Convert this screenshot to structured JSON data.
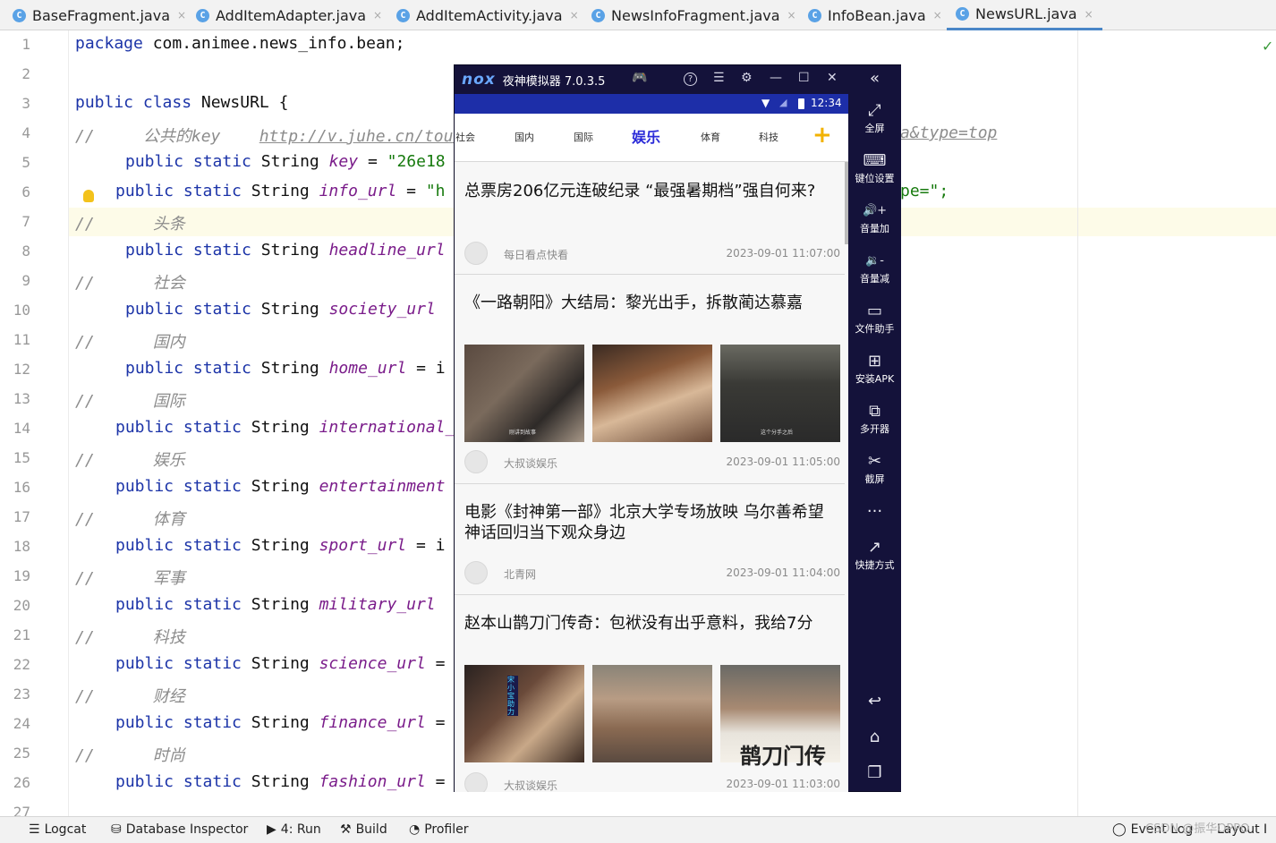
{
  "tabs": [
    {
      "label": "BaseFragment.java",
      "active": false
    },
    {
      "label": "AddItemAdapter.java",
      "active": false
    },
    {
      "label": "AddItemActivity.java",
      "active": false
    },
    {
      "label": "NewsInfoFragment.java",
      "active": false
    },
    {
      "label": "InfoBean.java",
      "active": false
    },
    {
      "label": "NewsURL.java",
      "active": true
    }
  ],
  "tab_icon": "C",
  "tab_close": "×",
  "line_numbers": [
    "1",
    "2",
    "3",
    "4",
    "5",
    "6",
    "7",
    "8",
    "9",
    "10",
    "11",
    "12",
    "13",
    "14",
    "15",
    "16",
    "17",
    "18",
    "19",
    "20",
    "21",
    "22",
    "23",
    "24",
    "25",
    "26",
    "27"
  ],
  "code": {
    "l1_kw": "package",
    "l1_rest": " com.animee.news_info.bean;",
    "l3_kw": "public class",
    "l3_rest": " NewsURL {",
    "l4_cm": "//     公共的key    ",
    "l4_link": "http://v.juhe.cn/tout",
    "l4_tail": "a&type=top",
    "l5_kw": "public static",
    "l5_type": " String ",
    "l5_field": "key",
    "l5_eq": " = ",
    "l5_str": "\"26e18",
    "l6_kw": "public static",
    "l6_type": " String ",
    "l6_field": "info_url",
    "l6_eq": " = ",
    "l6_str": "\"h",
    "l6_tail": "pe=\";",
    "l7_cm": "//      头条",
    "l8_kw": "public static",
    "l8_type": " String ",
    "l8_field": "headline_url",
    "l9_cm": "//      社会",
    "l10_kw": "public static",
    "l10_type": " String ",
    "l10_field": "society_url",
    "l11_cm": "//      国内",
    "l12_kw": "public static",
    "l12_type": " String ",
    "l12_field": "home_url",
    "l12_eq": " = i",
    "l13_cm": "//      国际",
    "l14_kw": "public static",
    "l14_type": " String ",
    "l14_field": "international_u",
    "l15_cm": "//      娱乐",
    "l16_kw": "public static",
    "l16_type": " String ",
    "l16_field": "entertainment",
    "l17_cm": "//      体育",
    "l18_kw": "public static",
    "l18_type": " String ",
    "l18_field": "sport_url",
    "l18_eq": " = i",
    "l19_cm": "//      军事",
    "l20_kw": "public static",
    "l20_type": " String ",
    "l20_field": "military_url",
    "l21_cm": "//      科技",
    "l22_kw": "public static",
    "l22_type": " String ",
    "l22_field": "science_url",
    "l22_eq": " =",
    "l23_cm": "//      财经",
    "l24_kw": "public static",
    "l24_type": " String ",
    "l24_field": "finance_url",
    "l24_eq": " =",
    "l25_cm": "//      时尚",
    "l26_kw": "public static",
    "l26_type": " String ",
    "l26_field": "fashion_url",
    "l26_eq": " ="
  },
  "check_mark": "✓",
  "bottom_bar": {
    "logcat": "Logcat",
    "db_inspector": "Database Inspector",
    "run": "4: Run",
    "build": "Build",
    "profiler": "Profiler",
    "event_log": "Event Log",
    "layout": "Layout I"
  },
  "watermark": "CSDN @振华OPPO",
  "emulator": {
    "logo": "nox",
    "title": "夜神模拟器 7.0.3.5",
    "titlebar_icons": {
      "gamepad": "🎮",
      "help": "?",
      "menu": "☰",
      "settings": "⚙",
      "minimize": "—",
      "maximize": "☐",
      "close": "✕",
      "collapse": "«"
    },
    "status_time": "12:34",
    "categories": [
      "社会",
      "国内",
      "国际",
      "娱乐",
      "体育",
      "科技"
    ],
    "active_category": "娱乐",
    "add_category": "+",
    "news": [
      {
        "title": "总票房206亿元连破纪录 “最强暑期档”强自何来?",
        "source": "每日看点快看",
        "time": "2023-09-01 11:07:00"
      },
      {
        "title": "《一路朝阳》大结局：黎光出手，拆散蔺达慕嘉",
        "source": "大叔谈娱乐",
        "time": "2023-09-01 11:05:00"
      },
      {
        "title": "电影《封神第一部》北京大学专场放映 乌尔善希望神话回归当下观众身边",
        "source": "北青网",
        "time": "2023-09-01 11:04:00"
      },
      {
        "title": "赵本山鹊刀门传奇：包袱没有出乎意料，我给7分",
        "source": "大叔谈娱乐",
        "time": "2023-09-01 11:03:00"
      }
    ],
    "image_captions": [
      "刚讲到故事",
      "这个分手之后",
      "宋小宝助力"
    ],
    "image_overlay": "鹊刀门传",
    "sidebar": [
      {
        "icon": "⤢",
        "label": "全屏"
      },
      {
        "icon": "⌨",
        "label": "键位设置"
      },
      {
        "icon": "🔊+",
        "label": "音量加"
      },
      {
        "icon": "🔉-",
        "label": "音量减"
      },
      {
        "icon": "▭",
        "label": "文件助手"
      },
      {
        "icon": "⊞",
        "label": "安装APK"
      },
      {
        "icon": "⧉",
        "label": "多开器"
      },
      {
        "icon": "✂",
        "label": "截屏"
      },
      {
        "icon": "···",
        "label": ""
      },
      {
        "icon": "↗",
        "label": "快捷方式"
      }
    ],
    "nav": {
      "back": "↩",
      "home": "⌂",
      "recent": "❐"
    }
  }
}
